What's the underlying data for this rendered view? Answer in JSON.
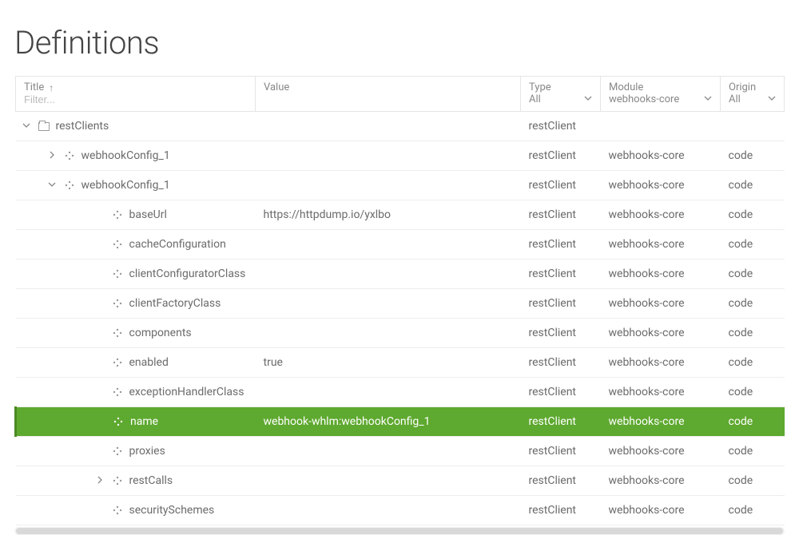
{
  "page": {
    "title": "Definitions"
  },
  "columns": {
    "title": {
      "label": "Title",
      "sort_dir": "asc",
      "filter_placeholder": "Filter..."
    },
    "value": {
      "label": "Value"
    },
    "type": {
      "label": "Type",
      "filter_value": "All"
    },
    "module": {
      "label": "Module",
      "filter_value": "webhooks-core"
    },
    "origin": {
      "label": "Origin",
      "filter_value": "All"
    }
  },
  "rows": [
    {
      "indent": 0,
      "expander": "down",
      "icon": "folder",
      "title": "restClients",
      "value": "",
      "type": "restClient",
      "module": "",
      "origin": "",
      "selected": false
    },
    {
      "indent": 1,
      "expander": "right",
      "icon": "node",
      "title": "webhookConfig_1",
      "value": "",
      "type": "restClient",
      "module": "webhooks-core",
      "origin": "code",
      "selected": false
    },
    {
      "indent": 1,
      "expander": "down",
      "icon": "node",
      "title": "webhookConfig_1",
      "value": "",
      "type": "restClient",
      "module": "webhooks-core",
      "origin": "code",
      "selected": false
    },
    {
      "indent": 2,
      "expander": "",
      "icon": "node",
      "title": "baseUrl",
      "value": "https://httpdump.io/yxlbo",
      "type": "restClient",
      "module": "webhooks-core",
      "origin": "code",
      "selected": false
    },
    {
      "indent": 2,
      "expander": "",
      "icon": "node",
      "title": "cacheConfiguration",
      "value": "",
      "type": "restClient",
      "module": "webhooks-core",
      "origin": "code",
      "selected": false
    },
    {
      "indent": 2,
      "expander": "",
      "icon": "node",
      "title": "clientConfiguratorClass",
      "value": "",
      "type": "restClient",
      "module": "webhooks-core",
      "origin": "code",
      "selected": false
    },
    {
      "indent": 2,
      "expander": "",
      "icon": "node",
      "title": "clientFactoryClass",
      "value": "",
      "type": "restClient",
      "module": "webhooks-core",
      "origin": "code",
      "selected": false
    },
    {
      "indent": 2,
      "expander": "",
      "icon": "node",
      "title": "components",
      "value": "",
      "type": "restClient",
      "module": "webhooks-core",
      "origin": "code",
      "selected": false
    },
    {
      "indent": 2,
      "expander": "",
      "icon": "node",
      "title": "enabled",
      "value": "true",
      "type": "restClient",
      "module": "webhooks-core",
      "origin": "code",
      "selected": false
    },
    {
      "indent": 2,
      "expander": "",
      "icon": "node",
      "title": "exceptionHandlerClass",
      "value": "",
      "type": "restClient",
      "module": "webhooks-core",
      "origin": "code",
      "selected": false
    },
    {
      "indent": 2,
      "expander": "",
      "icon": "node",
      "title": "name",
      "value": "webhook-whlm:webhookConfig_1",
      "type": "restClient",
      "module": "webhooks-core",
      "origin": "code",
      "selected": true
    },
    {
      "indent": 2,
      "expander": "",
      "icon": "node",
      "title": "proxies",
      "value": "",
      "type": "restClient",
      "module": "webhooks-core",
      "origin": "code",
      "selected": false
    },
    {
      "indent": 2,
      "expander": "right",
      "icon": "node",
      "title": "restCalls",
      "value": "",
      "type": "restClient",
      "module": "webhooks-core",
      "origin": "code",
      "selected": false
    },
    {
      "indent": 2,
      "expander": "",
      "icon": "node",
      "title": "securitySchemes",
      "value": "",
      "type": "restClient",
      "module": "webhooks-core",
      "origin": "code",
      "selected": false
    }
  ]
}
